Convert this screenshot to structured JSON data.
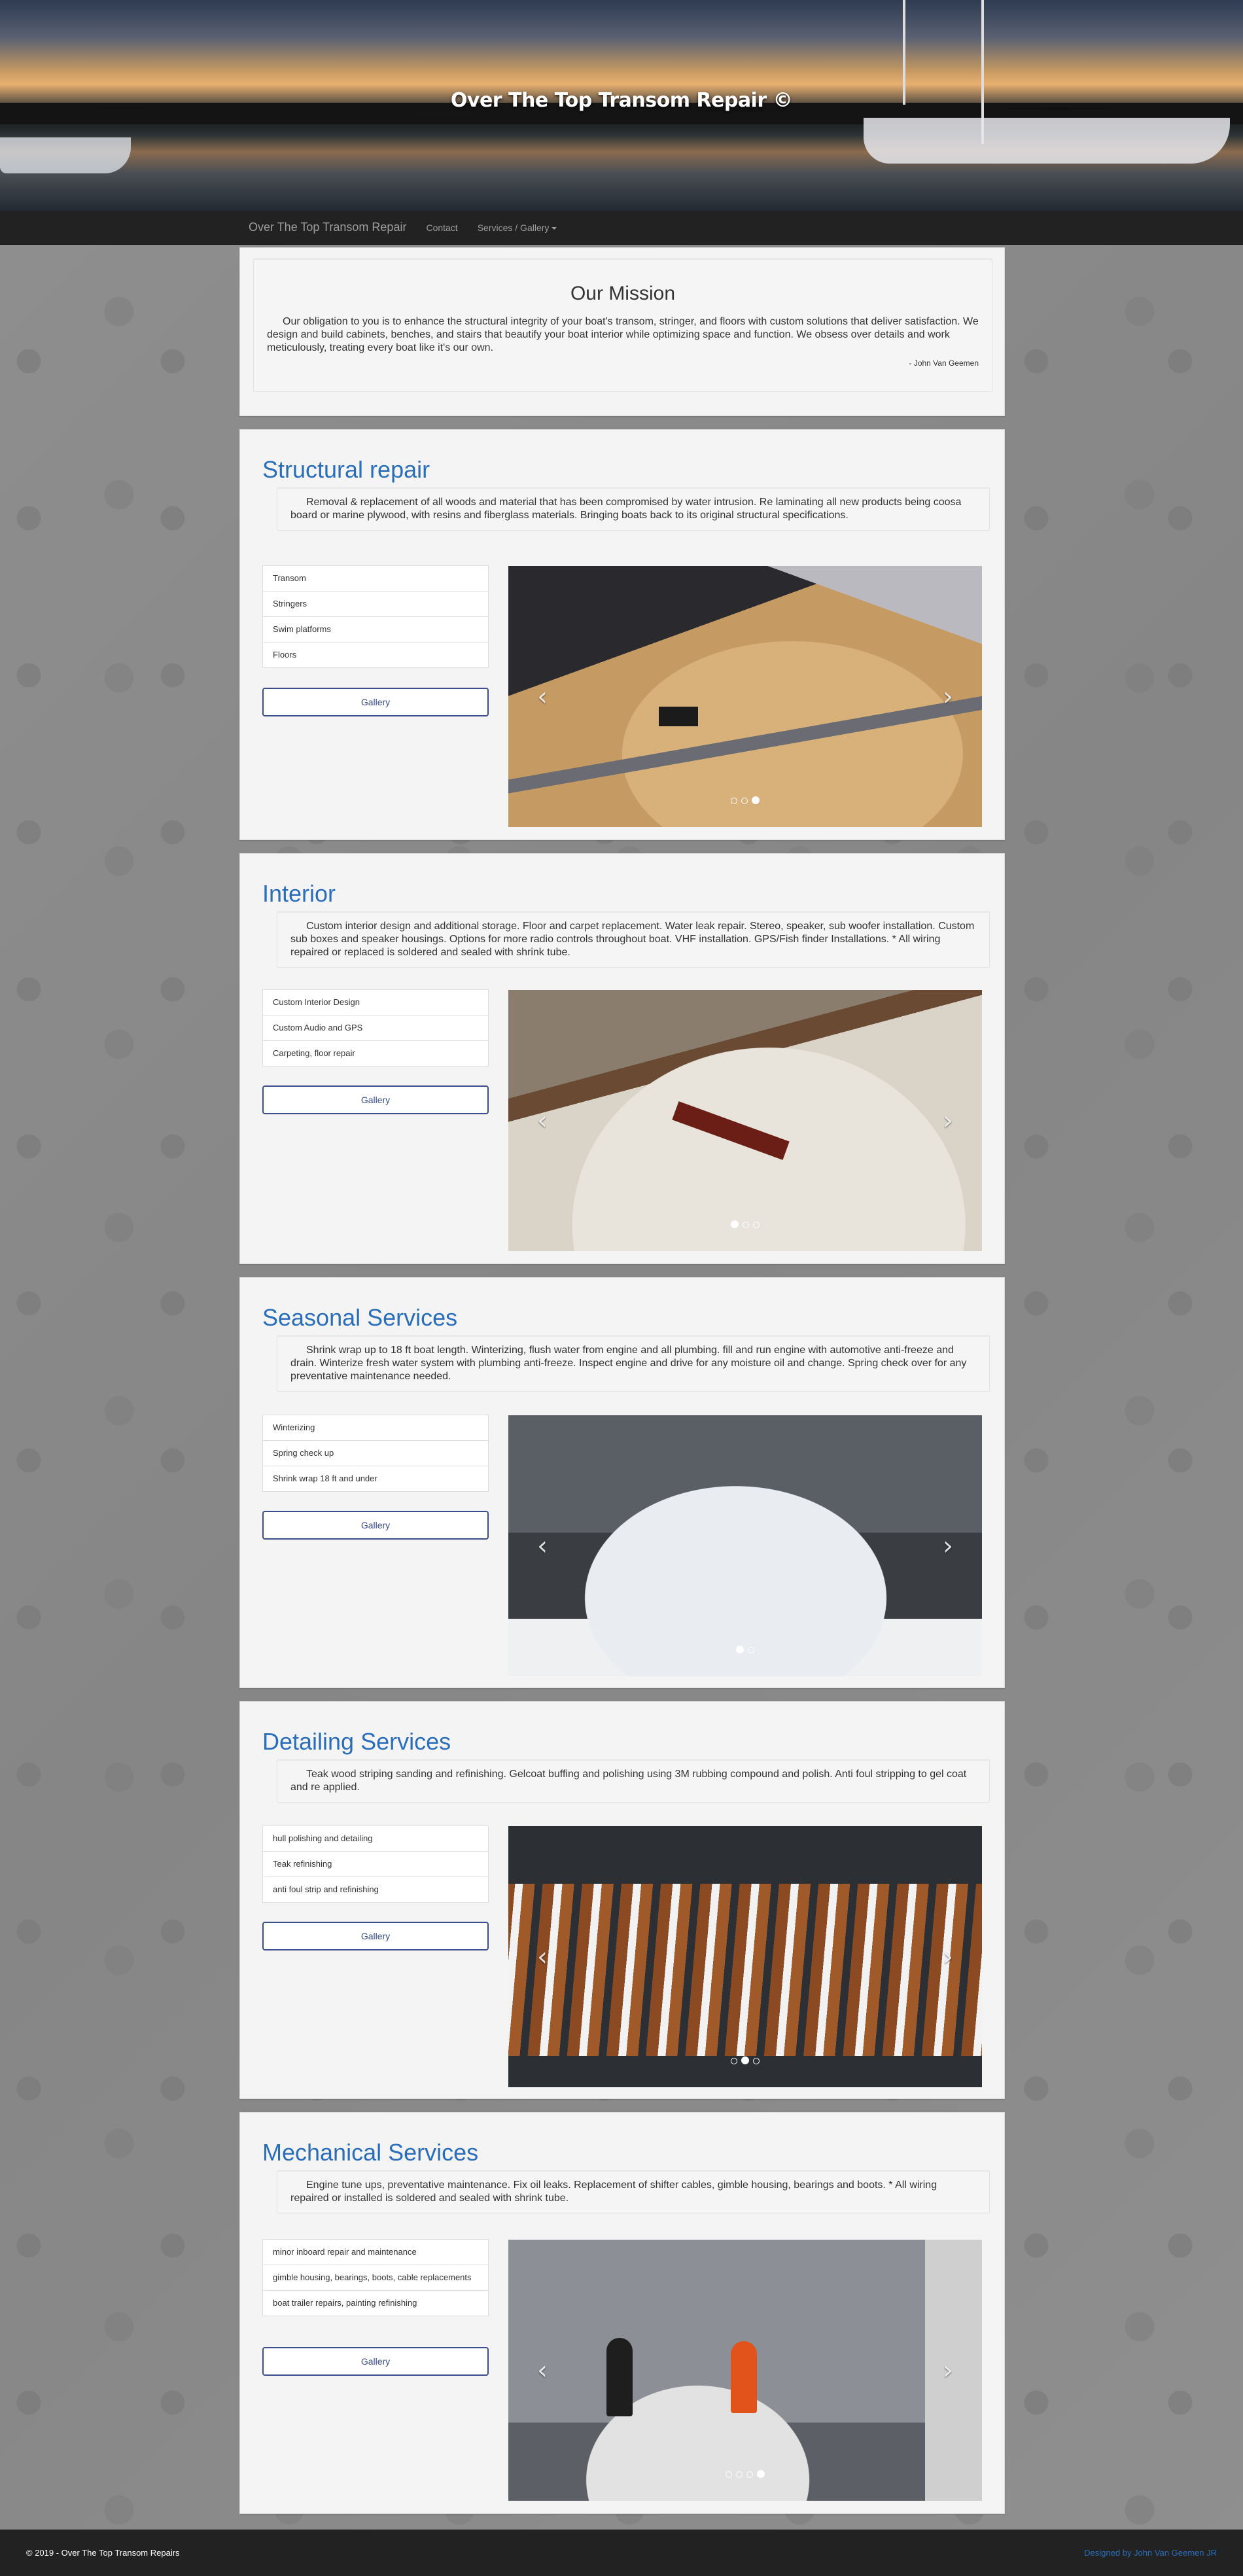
{
  "hero": {
    "title": "Over The Top Transom Repair ©"
  },
  "navbar": {
    "brand": "Over The Top Transom Repair",
    "contact": "Contact",
    "services": "Services / Gallery"
  },
  "mission": {
    "heading": "Our Mission",
    "text": "Our obligation to you is to enhance the structural integrity of your boat's transom, stringer, and floors with custom solutions that deliver satisfaction. We design and build cabinets, benches, and stairs that beautify your boat interior while optimizing space and function. We obsess over details and work meticulously, treating every boat like it's our own.",
    "signature": "- John Van Geemen"
  },
  "services": [
    {
      "title": "Structural repair",
      "description": "Removal & replacement of all woods and material that has been compromised by water intrusion. Re laminating all new products being coosa board or marine plywood, with resins and fiberglass materials. Bringing boats back to its original structural specifications.",
      "items": [
        "Transom",
        "Stringers",
        "Swim platforms",
        "Floors"
      ],
      "button": "Gallery",
      "dots": 3,
      "active_dot": 2
    },
    {
      "title": "Interior",
      "description": "Custom interior design and additional storage. Floor and carpet replacement. Water leak repair. Stereo, speaker, sub woofer installation. Custom sub boxes and speaker housings. Options for more radio controls throughout boat. VHF installation. GPS/Fish finder Installations. * All wiring repaired or replaced is soldered and sealed with shrink tube.",
      "items": [
        "Custom Interior Design",
        "Custom Audio and GPS",
        "Carpeting, floor repair"
      ],
      "button": "Gallery",
      "dots": 3,
      "active_dot": 0
    },
    {
      "title": "Seasonal Services",
      "description": "Shrink wrap up to 18 ft boat length. Winterizing, flush water from engine and all plumbing. fill and run engine with automotive anti-freeze and drain. Winterize fresh water system with plumbing anti-freeze. Inspect engine and drive for any moisture oil and change. Spring check over for any preventative maintenance needed.",
      "items": [
        "Winterizing",
        "Spring check up",
        "Shrink wrap 18 ft and under"
      ],
      "button": "Gallery",
      "dots": 2,
      "active_dot": 0
    },
    {
      "title": "Detailing Services",
      "description": "Teak wood striping sanding and refinishing. Gelcoat buffing and polishing using 3M rubbing compound and polish. Anti foul stripping to gel coat and re applied.",
      "items": [
        "hull polishing and detailing",
        "Teak refinishing",
        "anti foul strip and refinishing"
      ],
      "button": "Gallery",
      "dots": 3,
      "active_dot": 1
    },
    {
      "title": "Mechanical Services",
      "description": "Engine tune ups, preventative maintenance. Fix oil leaks. Replacement of shifter cables, gimble housing, bearings and boots. * All wiring repaired or installed is soldered and sealed with shrink tube.",
      "items": [
        "minor inboard repair and maintenance",
        "gimble housing, bearings, boots, cable replacements",
        "boat trailer repairs, painting refinishing"
      ],
      "button": "Gallery",
      "dots": 4,
      "active_dot": 3
    }
  ],
  "carousel": {
    "prev_icon": "chevron-left-icon",
    "next_icon": "chevron-right-icon",
    "prev": "‹",
    "next": "›"
  },
  "footer": {
    "copyright": "© 2019 - Over The Top Transom Repairs",
    "credit": "Designed by John Van Geemen JR"
  }
}
